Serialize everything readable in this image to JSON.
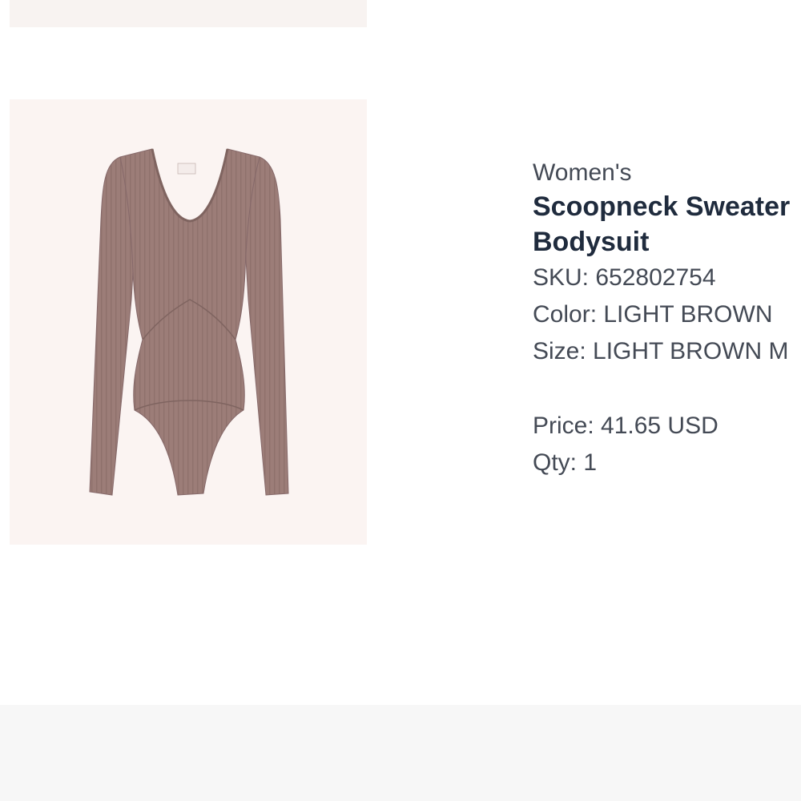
{
  "product": {
    "category": "Women's",
    "title": "Scoopneck Sweater Bodysuit",
    "sku_label": "SKU: 652802754",
    "color_label": "Color: LIGHT BROWN",
    "size_label": "Size: LIGHT BROWN M",
    "price_label": "Price: 41.65 USD",
    "qty_label": "Qty: 1",
    "garment_color": "#9c7d78",
    "image_background": "#fbf4f2"
  }
}
